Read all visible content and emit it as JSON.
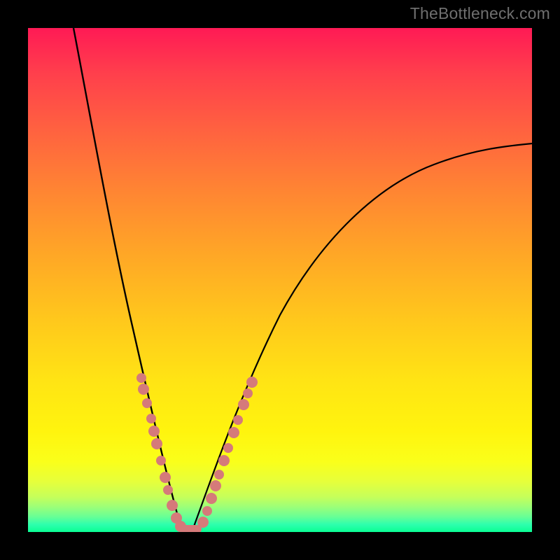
{
  "watermark": {
    "text": "TheBottleneck.com"
  },
  "chart_data": {
    "type": "line",
    "title": "",
    "xlabel": "",
    "ylabel": "",
    "xlim": [
      0,
      100
    ],
    "ylim": [
      0,
      100
    ],
    "series": [
      {
        "name": "left-curve",
        "x": [
          9,
          10,
          12,
          14,
          16,
          18,
          20,
          22,
          24,
          26,
          28,
          29,
          30
        ],
        "y": [
          100,
          90,
          75,
          62,
          50,
          40,
          31,
          23,
          16,
          10,
          5,
          2,
          0
        ]
      },
      {
        "name": "right-curve",
        "x": [
          30,
          32,
          34,
          37,
          40,
          44,
          48,
          53,
          58,
          64,
          71,
          78,
          86,
          94,
          100
        ],
        "y": [
          0,
          4,
          9,
          15,
          22,
          30,
          37,
          44,
          51,
          57,
          63,
          68,
          72,
          75,
          77
        ]
      },
      {
        "name": "left-dotted-segment",
        "x": [
          21,
          22,
          23,
          24,
          25,
          26,
          27,
          28,
          29,
          30,
          31,
          32
        ],
        "y": [
          29,
          25,
          22,
          18,
          14,
          11,
          8,
          5,
          3,
          1,
          0,
          0
        ]
      },
      {
        "name": "right-dotted-segment",
        "x": [
          32,
          33,
          34,
          35,
          36,
          37,
          38,
          39,
          40
        ],
        "y": [
          0,
          2,
          5,
          9,
          13,
          17,
          21,
          25,
          29
        ]
      }
    ],
    "grid": false,
    "legend": false,
    "background_gradient": {
      "orientation": "vertical",
      "stops": [
        {
          "pos": 0.0,
          "color": "#ff1a55"
        },
        {
          "pos": 0.45,
          "color": "#ffa726"
        },
        {
          "pos": 0.8,
          "color": "#fff40e"
        },
        {
          "pos": 1.0,
          "color": "#0aff94"
        }
      ]
    },
    "dot_color": "#d57a7a",
    "curve_color": "#000000"
  }
}
